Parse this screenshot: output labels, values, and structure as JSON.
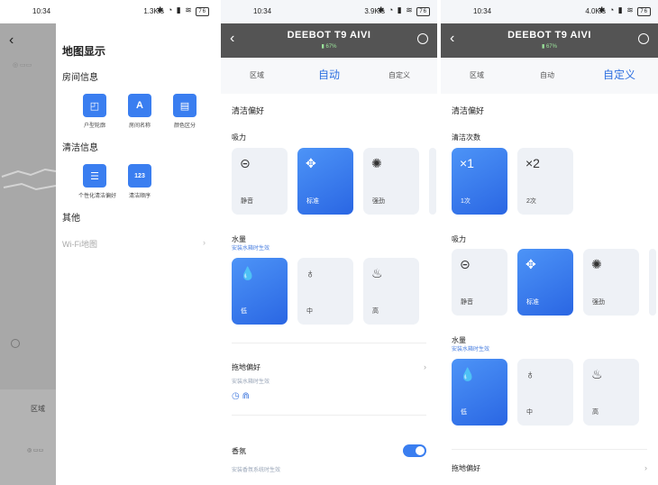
{
  "status": {
    "time": "10:34",
    "p1_speed": "1.3K/s",
    "p2_speed": "3.9K/s",
    "p3_speed": "4.0K/s",
    "battery": "76"
  },
  "panel1": {
    "drawer_title": "地图显示",
    "room_info": "房间信息",
    "room_tiles": [
      {
        "label": "户型轮廓",
        "icon": "outline-icon",
        "glyph": "◰"
      },
      {
        "label": "房间名称",
        "icon": "text-a-icon",
        "glyph": "A"
      },
      {
        "label": "颜色区分",
        "icon": "color-block-icon",
        "glyph": "▤"
      }
    ],
    "clean_info": "清洁信息",
    "clean_tiles": [
      {
        "label": "个性化清洁偏好",
        "icon": "sliders-icon",
        "glyph": "☰"
      },
      {
        "label": "清洁顺序",
        "icon": "order-123-icon",
        "glyph": "123"
      }
    ],
    "other": "其他",
    "wifi_map": "Wi-Fi地图",
    "region_tab": "区域"
  },
  "device": {
    "name": "DEEBOT T9 AIVI",
    "battery": "67%"
  },
  "tabs": {
    "area": "区域",
    "auto": "自动",
    "custom": "自定义"
  },
  "panel2": {
    "pref_title": "清洁偏好",
    "suction_title": "吸力",
    "suction": [
      {
        "label": "静音",
        "icon": "quiet-icon",
        "glyph": "⊝",
        "selected": false
      },
      {
        "label": "标准",
        "icon": "standard-fan-icon",
        "glyph": "✥",
        "selected": true
      },
      {
        "label": "强劲",
        "icon": "strong-fan-icon",
        "glyph": "✺",
        "selected": false
      }
    ],
    "water_title": "水量",
    "water_hint": "安装水箱时生效",
    "water": [
      {
        "label": "低",
        "icon": "drop-low-icon",
        "glyph": "💧",
        "selected": true
      },
      {
        "label": "中",
        "icon": "drop-mid-icon",
        "glyph": "♁",
        "selected": false
      },
      {
        "label": "高",
        "icon": "drop-high-icon",
        "glyph": "♨",
        "selected": false
      }
    ],
    "mop_title": "拖地偏好",
    "mop_hint": "安装水箱时生效",
    "scent_title": "香氛",
    "scent_hint": "安装香氛系统时生效"
  },
  "panel3": {
    "pref_title": "清洁偏好",
    "times_title": "清洁次数",
    "times": [
      {
        "label": "1次",
        "glyph": "×1",
        "selected": true
      },
      {
        "label": "2次",
        "glyph": "×2",
        "selected": false
      }
    ],
    "suction_title": "吸力",
    "suction": [
      {
        "label": "静音",
        "icon": "quiet-icon",
        "glyph": "⊝",
        "selected": false
      },
      {
        "label": "标准",
        "icon": "standard-fan-icon",
        "glyph": "✥",
        "selected": true
      },
      {
        "label": "强劲",
        "icon": "strong-fan-icon",
        "glyph": "✺",
        "selected": false
      }
    ],
    "water_title": "水量",
    "water_hint": "安装水箱时生效",
    "water": [
      {
        "label": "低",
        "icon": "drop-low-icon",
        "glyph": "💧",
        "selected": true
      },
      {
        "label": "中",
        "icon": "drop-mid-icon",
        "glyph": "♁",
        "selected": false
      },
      {
        "label": "高",
        "icon": "drop-high-icon",
        "glyph": "♨",
        "selected": false
      }
    ],
    "mop_title": "拖地偏好"
  }
}
